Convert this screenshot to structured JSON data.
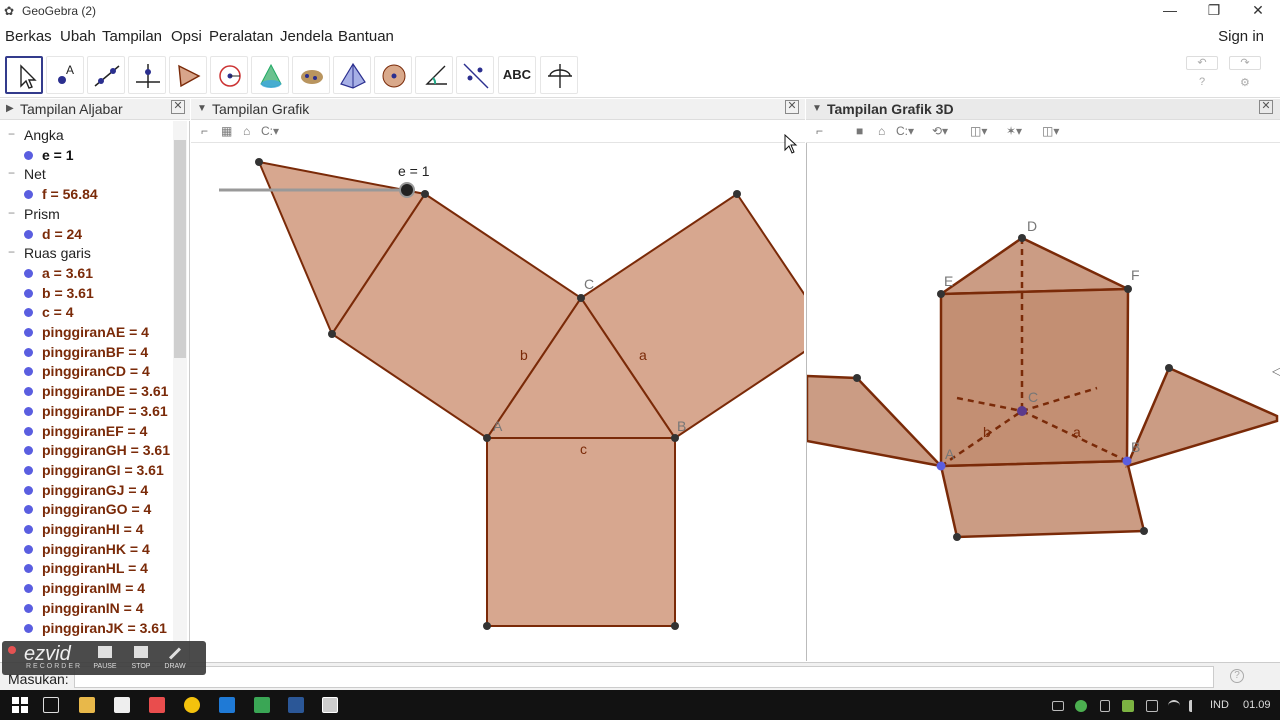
{
  "window": {
    "title": "GeoGebra (2)",
    "min": "—",
    "restore": "❐",
    "close": "✕"
  },
  "menu": [
    "Berkas",
    "Ubah",
    "Tampilan",
    "Opsi",
    "Peralatan",
    "Jendela",
    "Bantuan"
  ],
  "signin": "Sign in",
  "toolbar": {
    "text_tool_label": "ABC"
  },
  "algebra": {
    "title": "Tampilan Aljabar",
    "rows": [
      {
        "type": "category",
        "text": "Angka"
      },
      {
        "type": "item",
        "text": "e = 1",
        "color": "black"
      },
      {
        "type": "category",
        "text": "Net"
      },
      {
        "type": "item",
        "text": "f = 56.84"
      },
      {
        "type": "category",
        "text": "Prism"
      },
      {
        "type": "item",
        "text": "d = 24"
      },
      {
        "type": "category",
        "text": "Ruas garis"
      },
      {
        "type": "item",
        "text": "a = 3.61"
      },
      {
        "type": "item",
        "text": "b = 3.61"
      },
      {
        "type": "item",
        "text": "c = 4"
      },
      {
        "type": "item",
        "text": "pinggiranAE = 4"
      },
      {
        "type": "item",
        "text": "pinggiranBF = 4"
      },
      {
        "type": "item",
        "text": "pinggiranCD = 4"
      },
      {
        "type": "item",
        "text": "pinggiranDE = 3.61"
      },
      {
        "type": "item",
        "text": "pinggiranDF = 3.61"
      },
      {
        "type": "item",
        "text": "pinggiranEF = 4"
      },
      {
        "type": "item",
        "text": "pinggiranGH = 3.61"
      },
      {
        "type": "item",
        "text": "pinggiranGI = 3.61"
      },
      {
        "type": "item",
        "text": "pinggiranGJ = 4"
      },
      {
        "type": "item",
        "text": "pinggiranGO = 4"
      },
      {
        "type": "item",
        "text": "pinggiranHI = 4"
      },
      {
        "type": "item",
        "text": "pinggiranHK = 4"
      },
      {
        "type": "item",
        "text": "pinggiranHL = 4"
      },
      {
        "type": "item",
        "text": "pinggiranIM = 4"
      },
      {
        "type": "item",
        "text": "pinggiranIN = 4"
      },
      {
        "type": "item",
        "text": "pinggiranJK = 3.61"
      }
    ]
  },
  "graphics": {
    "title": "Tampilan Grafik",
    "slider_label": "e = 1",
    "point_c": "C",
    "point_a": "A",
    "point_b": "B",
    "seg_a": "a",
    "seg_b": "b",
    "seg_c": "c"
  },
  "view3d": {
    "title": "Tampilan Grafik 3D",
    "points": {
      "d": "D",
      "e": "E",
      "f": "F",
      "c": "C",
      "a": "A",
      "b": "B"
    },
    "seg_a": "a",
    "seg_b": "b"
  },
  "input": {
    "label": "Masukan:",
    "value": ""
  },
  "ezvid": {
    "brand": "ezvid",
    "sub": "RECORDER",
    "pause": "PAUSE",
    "stop": "STOP",
    "draw": "DRAW"
  },
  "tray": {
    "lang": "IND",
    "time": "01.09"
  },
  "colors": {
    "face": "#c98a6a",
    "edge": "#7a2a08",
    "accent": "#333b8c"
  }
}
